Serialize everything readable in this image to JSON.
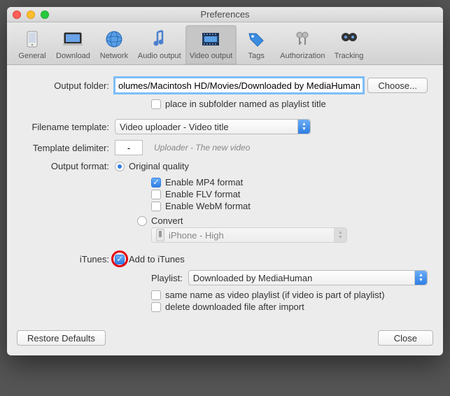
{
  "window": {
    "title": "Preferences"
  },
  "toolbar": {
    "items": [
      {
        "label": "General"
      },
      {
        "label": "Download"
      },
      {
        "label": "Network"
      },
      {
        "label": "Audio output"
      },
      {
        "label": "Video output"
      },
      {
        "label": "Tags"
      },
      {
        "label": "Authorization"
      },
      {
        "label": "Tracking"
      }
    ]
  },
  "labels": {
    "output_folder": "Output folder:",
    "filename_template": "Filename template:",
    "template_delimiter": "Template delimiter:",
    "output_format": "Output format:",
    "itunes": "iTunes:",
    "playlist": "Playlist:"
  },
  "output_folder": {
    "value": "olumes/Macintosh HD/Movies/Downloaded by MediaHuman",
    "choose": "Choose...",
    "subfolder": "place in subfolder named as playlist title"
  },
  "filename_template": {
    "selected": "Video uploader - Video title"
  },
  "template_delimiter": {
    "value": "-",
    "hint": "Uploader - The new video"
  },
  "output_format": {
    "original": "Original quality",
    "enable_mp4": "Enable MP4 format",
    "enable_flv": "Enable FLV format",
    "enable_webm": "Enable WebM format",
    "convert": "Convert",
    "convert_preset": "iPhone - High"
  },
  "itunes": {
    "add": "Add to iTunes",
    "playlist_selected": "Downloaded by MediaHuman",
    "same_name": "same name as video playlist (if video is part of playlist)",
    "delete_after": "delete downloaded file after import"
  },
  "footer": {
    "restore": "Restore Defaults",
    "close": "Close"
  }
}
